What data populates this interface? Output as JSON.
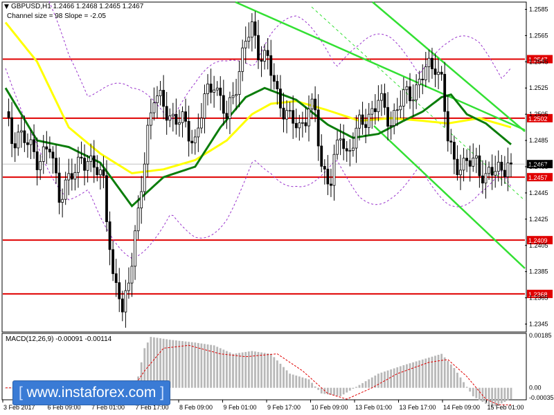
{
  "header": {
    "symbol_line": "GBPUSD,H1  1.2466 1.2468 1.2465 1.2467",
    "channel_line": "Channel size = 98 Slope = -2.05"
  },
  "macd": {
    "label": "MACD(12,26,9) -0.00091 -0.00114"
  },
  "watermark": {
    "open": "[",
    "text": "www.instaforex.com",
    "close": "]"
  },
  "colors": {
    "level_line": "#e00000",
    "price_label_bg": "#e00000",
    "ma_fast": "#0b7d0b",
    "ma_slow": "#ffff00",
    "channel": "#33e033",
    "bollinger": "#9933cc",
    "macd_hist": "#b8b8b8",
    "macd_signal": "#e00000"
  },
  "chart_data": {
    "type": "candlestick",
    "title": "GBPUSD,H1",
    "ohlc_last": {
      "open": 1.2466,
      "high": 1.2468,
      "low": 1.2465,
      "close": 1.2467
    },
    "ylim": [
      1.234,
      1.259
    ],
    "y_ticks": [
      "1.2585",
      "1.2565",
      "1.2545",
      "1.2525",
      "1.2505",
      "1.2485",
      "1.2465",
      "1.2445",
      "1.2425",
      "1.2405",
      "1.2385",
      "1.2365",
      "1.2345"
    ],
    "x_labels": [
      "3 Feb 2017",
      "6 Feb 09:00",
      "7 Feb 01:00",
      "7 Feb 17:00",
      "8 Feb 09:00",
      "9 Feb 01:00",
      "9 Feb 17:00",
      "10 Feb 09:00",
      "13 Feb 01:00",
      "13 Feb 17:00",
      "14 Feb 09:00",
      "15 Feb 01:00"
    ],
    "levels": [
      1.2547,
      1.2502,
      1.2457,
      1.2409,
      1.2368
    ],
    "level_labels": [
      "1.2547",
      "1.2502",
      "1.2457",
      "1.2409",
      "1.2368"
    ],
    "current_price": 1.2467,
    "current_price_label": "1.2467",
    "macd_ylim": [
      -0.00035,
      0.00185
    ],
    "macd_ticks": [
      "0.00185",
      "0.00",
      "-0.00035"
    ],
    "anchors": [
      [
        0,
        1.2503
      ],
      [
        2,
        1.2485
      ],
      [
        4,
        1.2492
      ],
      [
        8,
        1.2478
      ],
      [
        10,
        1.2472
      ],
      [
        14,
        1.2478
      ],
      [
        17,
        1.2445
      ],
      [
        22,
        1.246
      ],
      [
        24,
        1.2475
      ],
      [
        27,
        1.2465
      ],
      [
        31,
        1.2458
      ],
      [
        33,
        1.2405
      ],
      [
        34,
        1.2375
      ],
      [
        36,
        1.2368
      ],
      [
        37,
        1.2355
      ],
      [
        40,
        1.2395
      ],
      [
        42,
        1.2425
      ],
      [
        45,
        1.2495
      ],
      [
        47,
        1.252
      ],
      [
        50,
        1.251
      ],
      [
        52,
        1.2505
      ],
      [
        56,
        1.2498
      ],
      [
        60,
        1.2485
      ],
      [
        63,
        1.2515
      ],
      [
        66,
        1.2532
      ],
      [
        70,
        1.25
      ],
      [
        73,
        1.253
      ],
      [
        76,
        1.256
      ],
      [
        78,
        1.257
      ],
      [
        80,
        1.2555
      ],
      [
        83,
        1.2545
      ],
      [
        86,
        1.252
      ],
      [
        90,
        1.25
      ],
      [
        93,
        1.2495
      ],
      [
        96,
        1.251
      ],
      [
        98,
        1.2505
      ],
      [
        100,
        1.2465
      ],
      [
        103,
        1.2455
      ],
      [
        106,
        1.249
      ],
      [
        108,
        1.2475
      ],
      [
        112,
        1.2495
      ],
      [
        115,
        1.2505
      ],
      [
        118,
        1.2515
      ],
      [
        122,
        1.25
      ],
      [
        124,
        1.251
      ],
      [
        127,
        1.252
      ],
      [
        130,
        1.2525
      ],
      [
        133,
        1.2538
      ],
      [
        136,
        1.2545
      ],
      [
        138,
        1.253
      ],
      [
        140,
        1.2485
      ],
      [
        142,
        1.247
      ],
      [
        145,
        1.2465
      ],
      [
        149,
        1.247
      ],
      [
        152,
        1.2455
      ],
      [
        156,
        1.2465
      ],
      [
        160,
        1.2467
      ]
    ],
    "ma_fast": [
      [
        0,
        1.2525
      ],
      [
        10,
        1.2485
      ],
      [
        20,
        1.248
      ],
      [
        30,
        1.2468
      ],
      [
        40,
        1.2435
      ],
      [
        50,
        1.2457
      ],
      [
        60,
        1.2465
      ],
      [
        68,
        1.2495
      ],
      [
        76,
        1.2518
      ],
      [
        82,
        1.2525
      ],
      [
        92,
        1.2516
      ],
      [
        102,
        1.2497
      ],
      [
        110,
        1.2487
      ],
      [
        118,
        1.249
      ],
      [
        126,
        1.25
      ],
      [
        132,
        1.2507
      ],
      [
        138,
        1.2518
      ],
      [
        141,
        1.252
      ],
      [
        146,
        1.2505
      ],
      [
        152,
        1.2498
      ],
      [
        160,
        1.2482
      ]
    ],
    "ma_slow": [
      [
        0,
        1.2575
      ],
      [
        10,
        1.2545
      ],
      [
        20,
        1.2495
      ],
      [
        30,
        1.2475
      ],
      [
        40,
        1.246
      ],
      [
        50,
        1.2463
      ],
      [
        60,
        1.247
      ],
      [
        70,
        1.2485
      ],
      [
        78,
        1.2505
      ],
      [
        84,
        1.2513
      ],
      [
        92,
        1.2515
      ],
      [
        102,
        1.2508
      ],
      [
        112,
        1.25
      ],
      [
        122,
        1.2502
      ],
      [
        132,
        1.25
      ],
      [
        140,
        1.2498
      ],
      [
        150,
        1.2502
      ],
      [
        160,
        1.2495
      ]
    ],
    "macd_hist": [
      [
        0,
        0.0
      ],
      [
        10,
        0.0
      ],
      [
        20,
        0.0
      ],
      [
        30,
        0.0
      ],
      [
        38,
        -0.0003
      ],
      [
        42,
        0.0004
      ],
      [
        44,
        0.0014
      ],
      [
        46,
        0.0018
      ],
      [
        52,
        0.0017
      ],
      [
        60,
        0.0016
      ],
      [
        66,
        0.0015
      ],
      [
        72,
        0.0012
      ],
      [
        78,
        0.0013
      ],
      [
        84,
        0.0012
      ],
      [
        90,
        0.0005
      ],
      [
        96,
        0.0003
      ],
      [
        100,
        -0.0002
      ],
      [
        106,
        -0.0003
      ],
      [
        112,
        0.0001
      ],
      [
        118,
        0.0005
      ],
      [
        126,
        0.0008
      ],
      [
        132,
        0.001
      ],
      [
        138,
        0.0012
      ],
      [
        142,
        0.0007
      ],
      [
        148,
        -0.0003
      ],
      [
        154,
        -0.0007
      ],
      [
        160,
        -0.0004
      ]
    ],
    "macd_signal": [
      [
        0,
        0.0
      ],
      [
        30,
        0.0
      ],
      [
        38,
        -0.0004
      ],
      [
        44,
        0.0006
      ],
      [
        50,
        0.0014
      ],
      [
        58,
        0.0015
      ],
      [
        68,
        0.0012
      ],
      [
        76,
        0.0011
      ],
      [
        86,
        0.0012
      ],
      [
        94,
        0.0006
      ],
      [
        102,
        -0.0002
      ],
      [
        108,
        -0.0004
      ],
      [
        116,
        0.0
      ],
      [
        124,
        0.0005
      ],
      [
        134,
        0.0009
      ],
      [
        140,
        0.001
      ],
      [
        146,
        0.0004
      ],
      [
        152,
        -0.0004
      ],
      [
        156,
        -0.0006
      ],
      [
        160,
        -0.0006
      ]
    ]
  }
}
